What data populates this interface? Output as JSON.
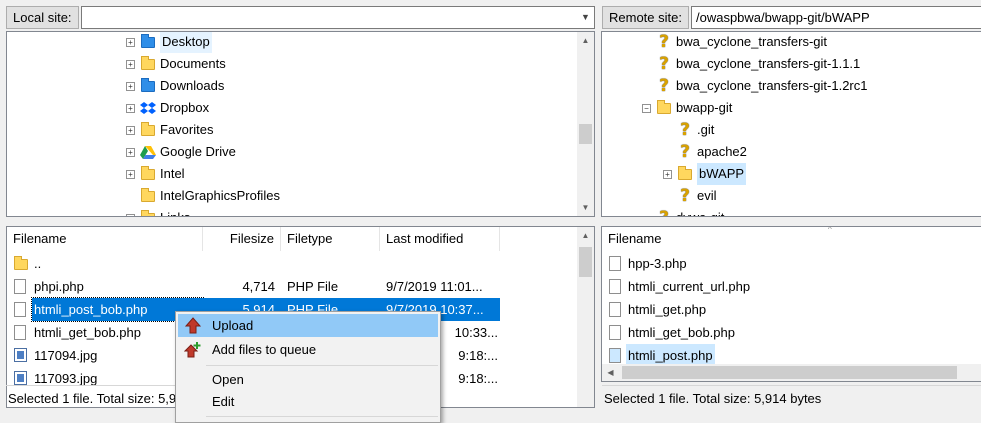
{
  "local": {
    "site_label": "Local site:",
    "site_path": "",
    "tree": [
      {
        "label": "Desktop",
        "icon": "desktop-folder-icon",
        "expander": "+",
        "highlight": true
      },
      {
        "label": "Documents",
        "icon": "documents-folder-icon",
        "expander": "+"
      },
      {
        "label": "Downloads",
        "icon": "downloads-folder-icon",
        "expander": "+"
      },
      {
        "label": "Dropbox",
        "icon": "dropbox-icon",
        "expander": "+"
      },
      {
        "label": "Favorites",
        "icon": "favorites-folder-icon",
        "expander": "+"
      },
      {
        "label": "Google Drive",
        "icon": "google-drive-icon",
        "expander": "+"
      },
      {
        "label": "Intel",
        "icon": "folder-icon",
        "expander": "+"
      },
      {
        "label": "IntelGraphicsProfiles",
        "icon": "folder-icon",
        "expander": ""
      },
      {
        "label": "Links",
        "icon": "folder-icon",
        "expander": "+"
      }
    ],
    "columns": {
      "filename": "Filename",
      "filesize": "Filesize",
      "filetype": "Filetype",
      "modified": "Last modified"
    },
    "files": [
      {
        "name": "..",
        "size": "",
        "type": "",
        "modified": "",
        "icon": "folder-icon"
      },
      {
        "name": "phpi.php",
        "size": "4,714",
        "type": "PHP File",
        "modified": "9/7/2019 11:01...",
        "icon": "php-file-icon"
      },
      {
        "name": "htmli_post_bob.php",
        "size": "5,914",
        "type": "PHP File",
        "modified": "9/7/2019 10:37...",
        "icon": "php-file-icon",
        "selected": true
      },
      {
        "name": "htmli_get_bob.php",
        "size": "",
        "type": "",
        "modified": "10:33...",
        "icon": "php-file-icon"
      },
      {
        "name": "117094.jpg",
        "size": "",
        "type": "",
        "modified": "9:18:...",
        "icon": "image-file-icon"
      },
      {
        "name": "117093.jpg",
        "size": "",
        "type": "",
        "modified": "9:18:...",
        "icon": "image-file-icon"
      }
    ],
    "status": "Selected 1 file. Total size: 5,9"
  },
  "remote": {
    "site_label": "Remote site:",
    "site_path": "/owaspbwa/bwapp-git/bWAPP",
    "tree": [
      {
        "label": "bwa_cyclone_transfers-git",
        "icon": "unknown-folder-icon",
        "indent": 0
      },
      {
        "label": "bwa_cyclone_transfers-git-1.1.1",
        "icon": "unknown-folder-icon",
        "indent": 0
      },
      {
        "label": "bwa_cyclone_transfers-git-1.2rc1",
        "icon": "unknown-folder-icon",
        "indent": 0
      },
      {
        "label": "bwapp-git",
        "icon": "folder-icon",
        "indent": 0,
        "expander": "−"
      },
      {
        "label": ".git",
        "icon": "unknown-folder-icon",
        "indent": 1
      },
      {
        "label": "apache2",
        "icon": "unknown-folder-icon",
        "indent": 1
      },
      {
        "label": "bWAPP",
        "icon": "folder-icon",
        "indent": 1,
        "expander": "+",
        "highlight": true
      },
      {
        "label": "evil",
        "icon": "unknown-folder-icon",
        "indent": 1
      },
      {
        "label": "dvwa-git",
        "icon": "unknown-folder-icon",
        "indent": 0
      }
    ],
    "columns": {
      "filename": "Filename"
    },
    "files": [
      {
        "name": "hpp-3.php"
      },
      {
        "name": "htmli_current_url.php"
      },
      {
        "name": "htmli_get.php"
      },
      {
        "name": "htmli_get_bob.php"
      },
      {
        "name": "htmli_post.php",
        "highlight": true
      }
    ],
    "status": "Selected 1 file. Total size: 5,914 bytes"
  },
  "context_menu": {
    "items": [
      {
        "label": "Upload",
        "icon": "upload-arrow-icon",
        "active": true
      },
      {
        "label": "Add files to queue",
        "icon": "add-to-queue-icon"
      },
      {
        "label": "Open"
      },
      {
        "label": "Edit"
      }
    ]
  },
  "colors": {
    "selection": "#0078d7",
    "menu_highlight": "#91c9f7",
    "folder": "#ffd75e"
  }
}
